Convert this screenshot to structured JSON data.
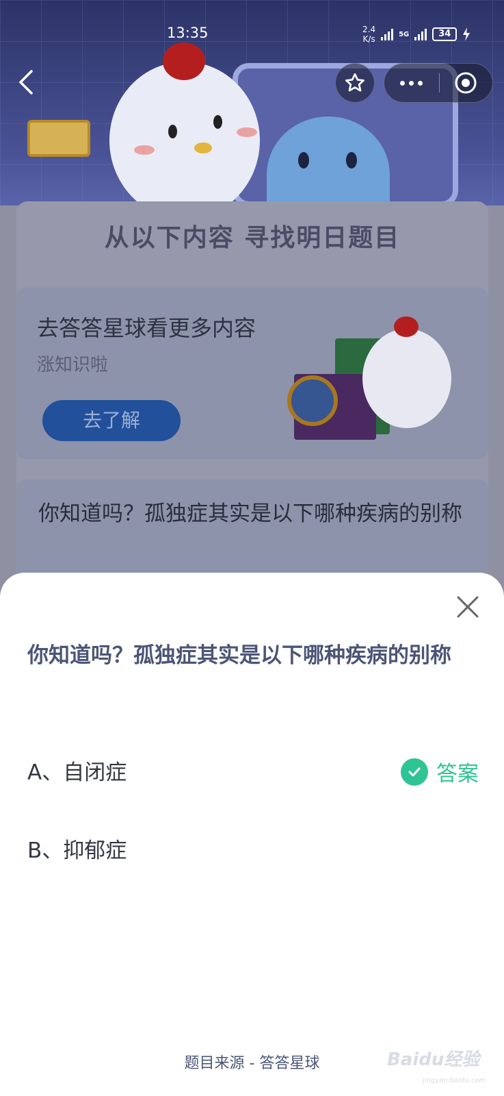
{
  "status_bar": {
    "time": "13:35",
    "net_speed_value": "2.4",
    "net_speed_unit": "K/s",
    "network_type": "5G",
    "battery": "34"
  },
  "nav": {
    "back_icon": "chevron-left-icon",
    "favorite_icon": "star-icon",
    "more_icon": "more-dots-icon",
    "close_app_icon": "target-icon"
  },
  "background_page": {
    "banner_title": "从以下内容  寻找明日题目",
    "learn_card": {
      "title": "去答答星球看更多内容",
      "subtitle": "涨知识啦",
      "button_label": "去了解"
    },
    "question_card": {
      "text": "你知道吗？孤独症其实是以下哪种疾病的别称"
    }
  },
  "sheet": {
    "question": "你知道吗？孤独症其实是以下哪种疾病的别称",
    "options": [
      {
        "label": "A、自闭症",
        "is_answer": true
      },
      {
        "label": "B、抑郁症",
        "is_answer": false
      }
    ],
    "answer_label": "答案",
    "source": "题目来源 - 答答星球",
    "accent_color": "#2fc493"
  },
  "watermark": {
    "logo_text": "Baidu经验",
    "url": "jingyan.baidu.com"
  }
}
